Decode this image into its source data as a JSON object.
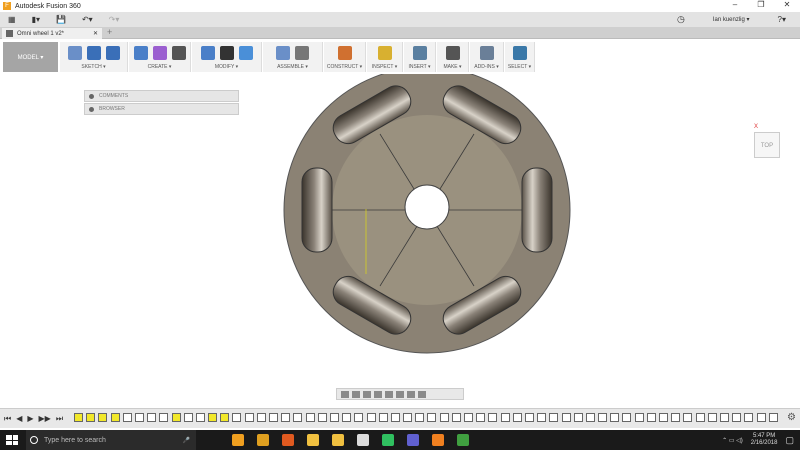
{
  "title": "Autodesk Fusion 360",
  "window_controls": [
    "–",
    "❐",
    "✕"
  ],
  "qat": {
    "grid": "▦",
    "file": "▮▾",
    "save": "💾",
    "undo": "↶▾",
    "redo": "↷▾",
    "user": "Ian kuenzlig ▾",
    "help": "?▾",
    "history": "◷"
  },
  "doc_tab": {
    "label": "Omni wheel 1 v2*",
    "close": "✕",
    "new": "+"
  },
  "workspace": "MODEL ▾",
  "groups": [
    {
      "label": "SKETCH ▾",
      "colors": [
        "#6a8fc8",
        "#3a6fb8",
        "#3a6fb8"
      ]
    },
    {
      "label": "CREATE ▾",
      "colors": [
        "#4a7fc8",
        "#9b5fd0",
        "#555"
      ]
    },
    {
      "label": "MODIFY ▾",
      "colors": [
        "#4a7fc8",
        "#333",
        "#4a8fd8"
      ]
    },
    {
      "label": "ASSEMBLE ▾",
      "colors": [
        "#6a8fc8",
        "#777"
      ]
    },
    {
      "label": "CONSTRUCT ▾",
      "colors": [
        "#d07030"
      ]
    },
    {
      "label": "INSPECT ▾",
      "colors": [
        "#d8b030"
      ]
    },
    {
      "label": "INSERT ▾",
      "colors": [
        "#5a7fa0"
      ]
    },
    {
      "label": "MAKE ▾",
      "colors": [
        "#555"
      ]
    },
    {
      "label": "ADD-INS ▾",
      "colors": [
        "#6a7f98"
      ]
    },
    {
      "label": "SELECT ▾",
      "colors": [
        "#3a78a8"
      ]
    }
  ],
  "panels": [
    "COMMENTS",
    "BROWSER"
  ],
  "viewcube": {
    "face": "TOP",
    "axis_x": "X"
  },
  "timeline": {
    "controls": [
      "⏮",
      "◀",
      "▶",
      "▶▶",
      "⏭"
    ],
    "settings": "⚙",
    "items": "yyyyxxxxyxxyyxxxxxxxxxxxxxxxxxxxxxxxxxxxxxxxxxxxxxxxxxxxxx"
  },
  "taskbar": {
    "search_placeholder": "Type here to search",
    "mic": "🎤",
    "time": "5:47 PM",
    "date": "2/16/2018",
    "app_colors": [
      "#f0a020",
      "#e0a020",
      "#e05a20",
      "#f0c040",
      "#f0c040",
      "#ddd",
      "#30c060",
      "#6060d0",
      "#f08020",
      "#40a040"
    ]
  }
}
